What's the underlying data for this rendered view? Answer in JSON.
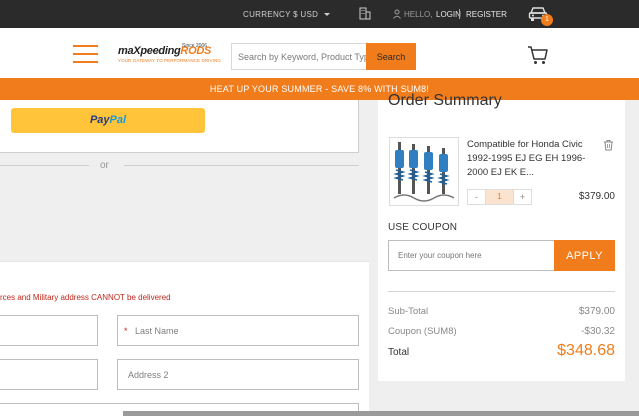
{
  "topbar": {
    "currency_label": "CURRENCY",
    "currency_value": "$ USD",
    "hello_label": "HELLO,",
    "login_label": "LOGIN",
    "register_label": "REGISTER"
  },
  "header": {
    "logo_text_a": "maX",
    "logo_text_b": "peeding",
    "logo_text_c": "RODS",
    "logo_since": "Since 2006",
    "logo_tagline": "YOUR GATEWAY TO PERFORMANCE DRIVING",
    "search_placeholder": "Search by Keyword, Product Type",
    "search_button": "Search",
    "cart_count": "1"
  },
  "promo": {
    "text": "HEAT UP YOUR SUMMER - SAVE 8% WITH SUM8!"
  },
  "payment": {
    "paypal_a": "Pay",
    "paypal_b": "Pal",
    "or_text": "or"
  },
  "form": {
    "warning": "rces and Military address CANNOT be delivered",
    "last_name_placeholder": "Last Name",
    "address2_placeholder": "Address 2",
    "required_mark": "*"
  },
  "summary": {
    "title": "Order Summary",
    "product_name": "Compatible for Honda Civic 1992-1995 EJ EG EH 1996-2000 EJ EK E...",
    "quantity": "1",
    "minus": "-",
    "plus": "+",
    "product_price": "$379.00",
    "coupon_label": "USE COUPON",
    "coupon_placeholder": "Enter your coupon here",
    "apply_button": "APPLY",
    "subtotal_label": "Sub-Total",
    "subtotal_value": "$379.00",
    "coupon_row_label": "Coupon (SUM8)",
    "coupon_row_value": "-$30.32",
    "total_label": "Total",
    "total_value": "$348.68"
  },
  "colors": {
    "accent": "#f07c1b",
    "topbar": "#2b2b2b",
    "paypal_yellow": "#ffc439",
    "warning_red": "#c0271c"
  }
}
